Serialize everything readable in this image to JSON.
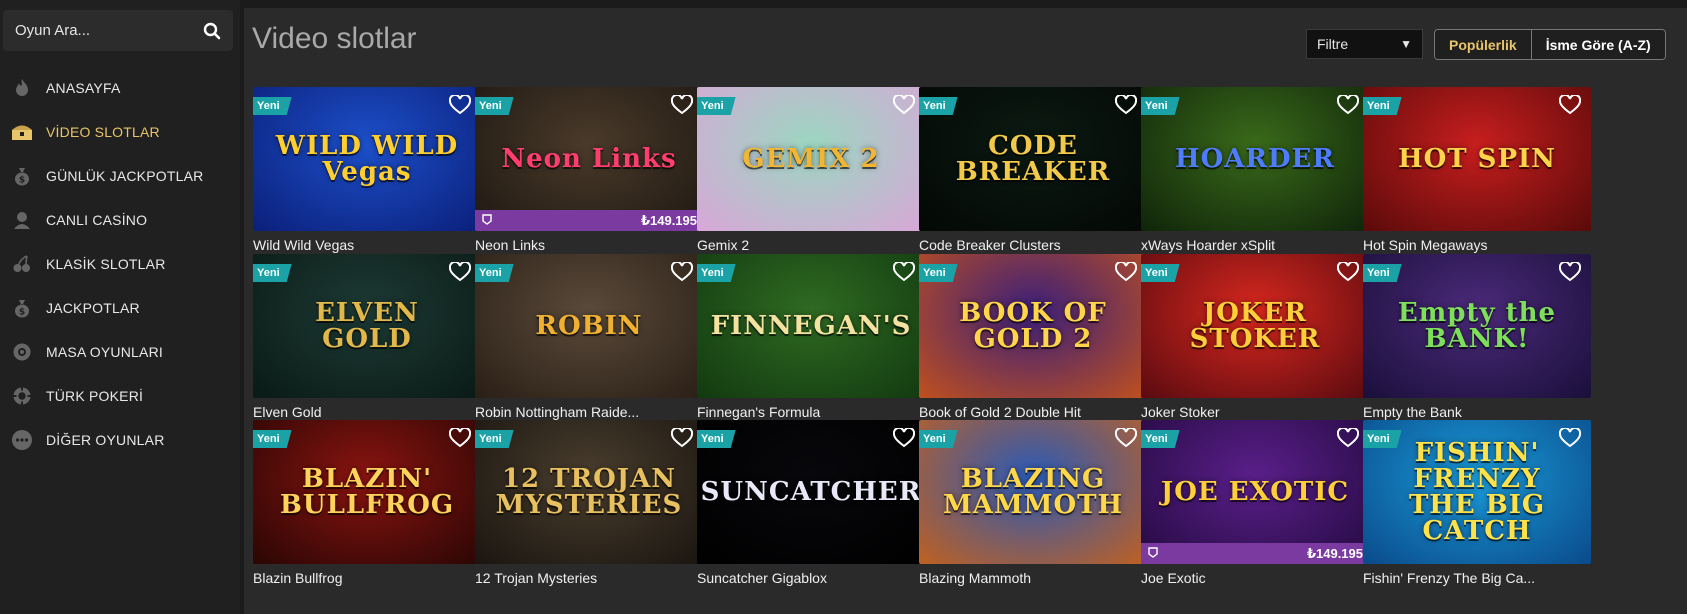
{
  "search": {
    "placeholder": "Oyun Ara..."
  },
  "nav": [
    {
      "label": "ANASAYFA",
      "icon": "flame-icon",
      "active": false
    },
    {
      "label": "VİDEO SLOTLAR",
      "icon": "treasure-chest-icon",
      "active": true
    },
    {
      "label": "GÜNLÜK JACKPOTLAR",
      "icon": "money-bag-icon",
      "active": false
    },
    {
      "label": "CANLI CASİNO",
      "icon": "dealer-icon",
      "active": false
    },
    {
      "label": "KLASİK SLOTLAR",
      "icon": "cherry-icon",
      "active": false
    },
    {
      "label": "JACKPOTLAR",
      "icon": "money-bag-icon",
      "active": false
    },
    {
      "label": "MASA OYUNLARI",
      "icon": "roulette-icon",
      "active": false
    },
    {
      "label": "TÜRK POKERİ",
      "icon": "poker-chip-icon",
      "active": false
    },
    {
      "label": "DİĞER OYUNLAR",
      "icon": "more-dots-icon",
      "active": false
    }
  ],
  "page": {
    "title": "Video slotlar"
  },
  "filter": {
    "label": "Filtre"
  },
  "sort": {
    "popular": "Popülerlik",
    "alpha": "İsme Göre (A-Z)"
  },
  "badge_label": "Yeni",
  "games": [
    {
      "name": "Wild Wild Vegas",
      "logo": "WILD WILD Vegas",
      "bg": "#1c4fc9",
      "bg2": "#0b1f7a",
      "fg": "#ffcf2e",
      "jackpot": ""
    },
    {
      "name": "Neon Links",
      "logo": "Neon Links",
      "bg": "#4a3a2a",
      "bg2": "#1e1812",
      "fg": "#ff3d6e",
      "jackpot": "₺149.195"
    },
    {
      "name": "Gemix 2",
      "logo": "GEMIX 2",
      "bg": "#9bd6c0",
      "bg2": "#d9a7d8",
      "fg": "#f2b632",
      "jackpot": ""
    },
    {
      "name": "Code Breaker Clusters",
      "logo": "CODE BREAKER",
      "bg": "#0c1a12",
      "bg2": "#030805",
      "fg": "#f3c94a",
      "jackpot": ""
    },
    {
      "name": "xWays Hoarder xSplit",
      "logo": "HOARDER",
      "bg": "#3a6a1a",
      "bg2": "#0f240a",
      "fg": "#4e7cff",
      "jackpot": ""
    },
    {
      "name": "Hot Spin Megaways",
      "logo": "HOT SPIN",
      "bg": "#c81e1e",
      "bg2": "#5a0a0a",
      "fg": "#ffd34a",
      "jackpot": ""
    },
    {
      "name": "Elven Gold",
      "logo": "ELVEN GOLD",
      "bg": "#1d3a34",
      "bg2": "#0a1a16",
      "fg": "#e3b84a",
      "jackpot": ""
    },
    {
      "name": "Robin Nottingham Raide...",
      "logo": "ROBIN",
      "bg": "#5a4a3a",
      "bg2": "#2a1f16",
      "fg": "#f0b030",
      "jackpot": ""
    },
    {
      "name": "Finnegan's Formula",
      "logo": "FINNEGAN'S",
      "bg": "#2f6a22",
      "bg2": "#123a10",
      "fg": "#f4e3a0",
      "jackpot": ""
    },
    {
      "name": "Book of Gold 2 Double Hit",
      "logo": "BOOK OF GOLD 2",
      "bg": "#3b1f7a",
      "bg2": "#c0501e",
      "fg": "#ffd54a",
      "jackpot": ""
    },
    {
      "name": "Joker Stoker",
      "logo": "JOKER STOKER",
      "bg": "#d8281e",
      "bg2": "#5a0a10",
      "fg": "#ffcf3a",
      "jackpot": ""
    },
    {
      "name": "Empty the Bank",
      "logo": "Empty the BANK!",
      "bg": "#4b2a7a",
      "bg2": "#1a0f3a",
      "fg": "#7ee05a",
      "jackpot": ""
    },
    {
      "name": "Blazin Bullfrog",
      "logo": "BLAZIN' BULLFROG",
      "bg": "#8a1410",
      "bg2": "#2a0604",
      "fg": "#ffd25a",
      "jackpot": ""
    },
    {
      "name": "12 Trojan Mysteries",
      "logo": "12 TROJAN MYSTERIES",
      "bg": "#4a3e2e",
      "bg2": "#1a1510",
      "fg": "#e8c060",
      "jackpot": ""
    },
    {
      "name": "Suncatcher Gigablox",
      "logo": "SUNCATCHER",
      "bg": "#08080c",
      "bg2": "#000000",
      "fg": "#e8e8f8",
      "jackpot": ""
    },
    {
      "name": "Blazing Mammoth",
      "logo": "BLAZING MAMMOTH",
      "bg": "#2a5ab8",
      "bg2": "#c06020",
      "fg": "#ffd84a",
      "jackpot": ""
    },
    {
      "name": "Joe Exotic",
      "logo": "JOE EXOTIC",
      "bg": "#5a1f8a",
      "bg2": "#240a40",
      "fg": "#ffcf3a",
      "jackpot": "₺149.195"
    },
    {
      "name": "Fishin' Frenzy The Big Ca...",
      "logo": "FISHIN' FRENZY THE BIG CATCH",
      "bg": "#1a9ad8",
      "bg2": "#0a4a8a",
      "fg": "#ffe24a",
      "jackpot": ""
    }
  ]
}
